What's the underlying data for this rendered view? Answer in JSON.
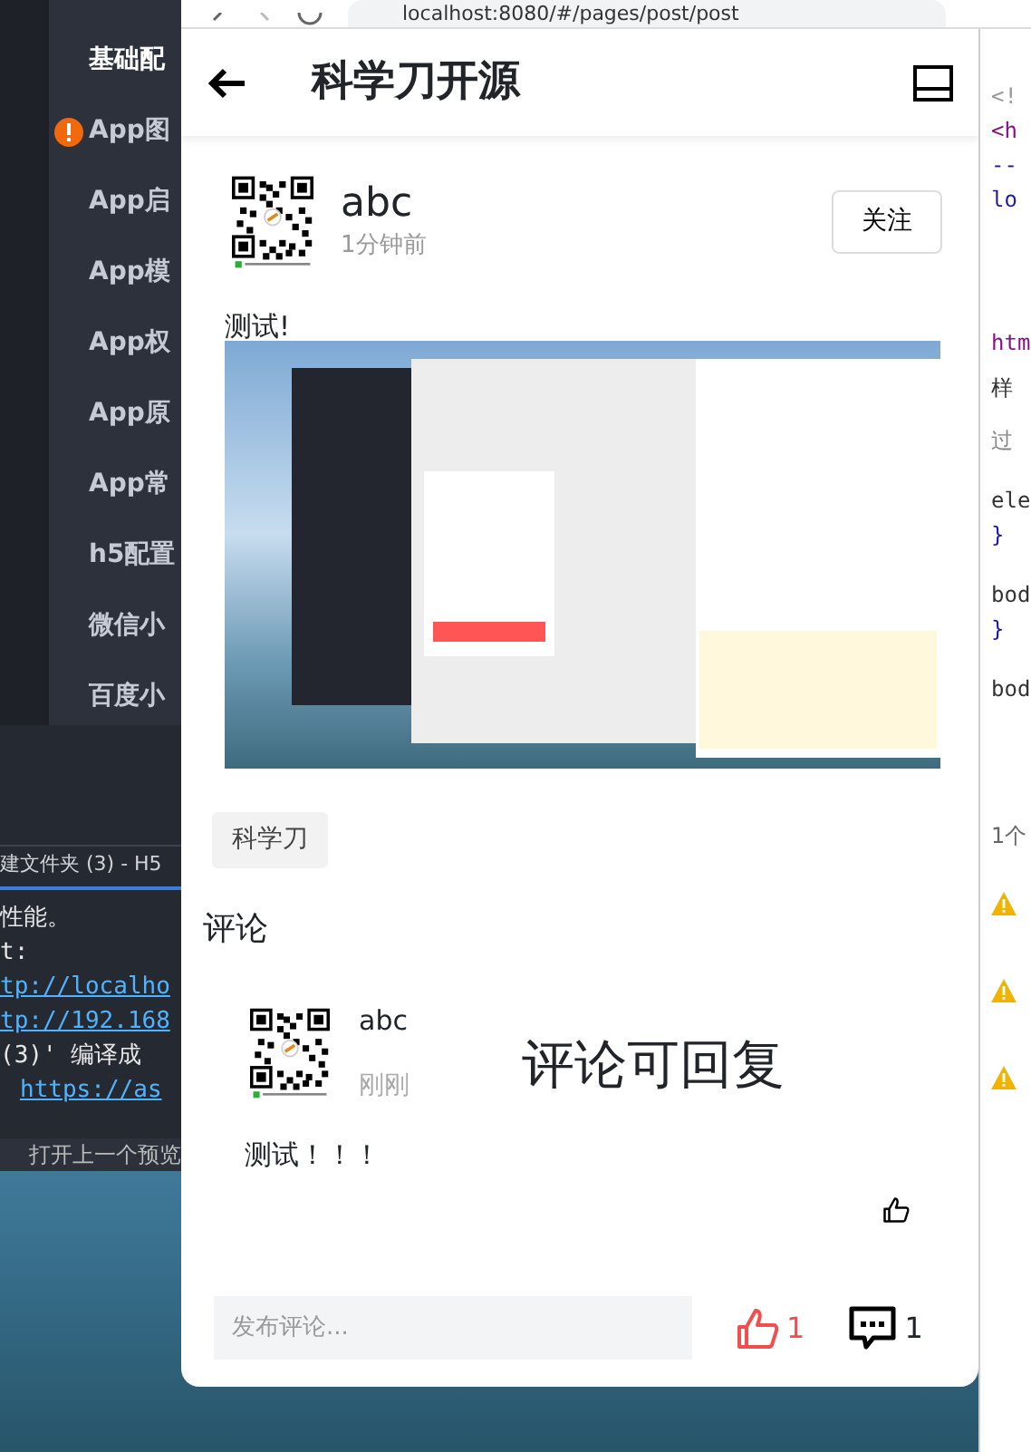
{
  "ide": {
    "sidebar_items": [
      {
        "label": "基础配",
        "warning": false
      },
      {
        "label": "App图",
        "warning": true
      },
      {
        "label": "App启",
        "warning": false
      },
      {
        "label": "App模",
        "warning": false
      },
      {
        "label": "App权",
        "warning": false
      },
      {
        "label": "App原",
        "warning": false
      },
      {
        "label": "App常",
        "warning": false
      },
      {
        "label": "h5配置",
        "warning": false
      },
      {
        "label": "微信小",
        "warning": false
      },
      {
        "label": "百度小",
        "warning": false
      }
    ],
    "terminal_tab": "建文件夹 (3) - H5",
    "terminal_lines": [
      {
        "text": "性能。",
        "kind": "text"
      },
      {
        "text": "t:",
        "kind": "text"
      },
      {
        "text": "tp://localho",
        "kind": "link"
      },
      {
        "text": "tp://192.168",
        "kind": "link"
      },
      {
        "text": "(3)' 编译成",
        "kind": "text"
      },
      {
        "text": "https://as",
        "kind": "link"
      }
    ],
    "status_text": "打开上一个预览"
  },
  "browser": {
    "url": "localhost:8080/#/pages/post/post"
  },
  "page": {
    "title": "科学刀开源",
    "author": {
      "name": "abc",
      "time": "1分钟前"
    },
    "follow_label": "关注",
    "post_text": "测试!",
    "tag": "科学刀",
    "comments_heading": "评论",
    "comment": {
      "name": "abc",
      "time": "刚刚",
      "text": "测试！！！",
      "liked": false
    },
    "note": "评论可回复",
    "comment_input": {
      "placeholder": "发布评论..."
    },
    "likes": {
      "count": "1",
      "liked": true
    },
    "comment_count": "1"
  },
  "devtools": [
    {
      "text": "<!",
      "kind": "comment"
    },
    {
      "text": "<h",
      "kind": "tag"
    },
    {
      "text": "--",
      "kind": "code"
    },
    {
      "text": "lo",
      "kind": "code"
    },
    {
      "text": "htm",
      "kind": "crumb"
    },
    {
      "text": "样",
      "kind": "tab"
    },
    {
      "text": "过",
      "kind": "filter"
    },
    {
      "text": "ele",
      "kind": "selector"
    },
    {
      "text": "}",
      "kind": "code"
    },
    {
      "text": "bod",
      "kind": "selector"
    },
    {
      "text": "}",
      "kind": "code"
    },
    {
      "text": "bod",
      "kind": "selector"
    },
    {
      "text": "1个",
      "kind": "count"
    }
  ]
}
